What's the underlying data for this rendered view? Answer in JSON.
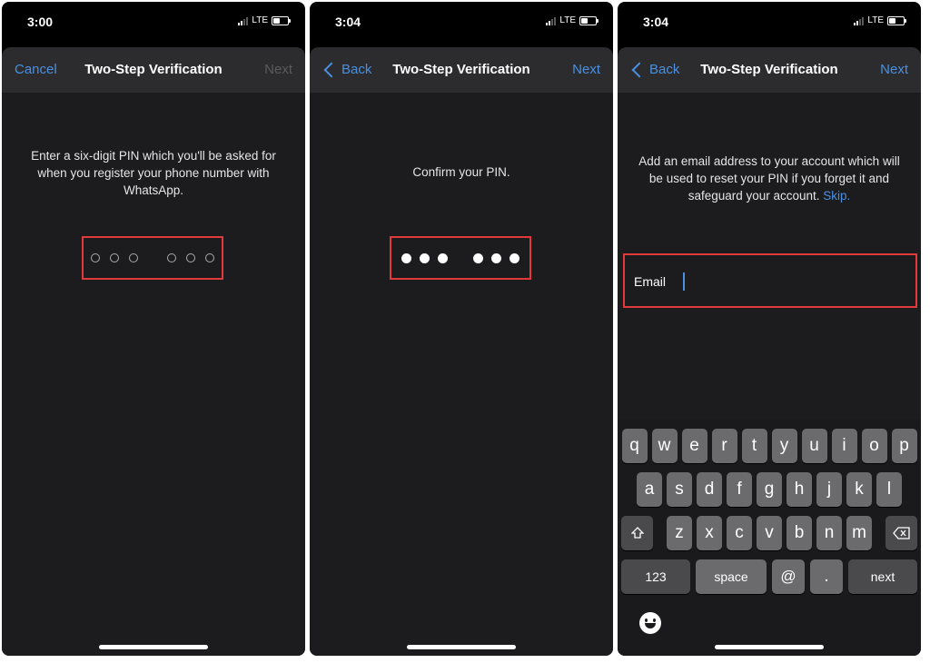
{
  "screens": [
    {
      "time": "3:00",
      "network": "LTE",
      "nav": {
        "left": "Cancel",
        "title": "Two-Step Verification",
        "right": "Next"
      },
      "message": "Enter a six-digit PIN which you'll be asked for when you register your phone number with WhatsApp."
    },
    {
      "time": "3:04",
      "network": "LTE",
      "nav": {
        "left": "Back",
        "title": "Two-Step Verification",
        "right": "Next"
      },
      "message": "Confirm your PIN."
    },
    {
      "time": "3:04",
      "network": "LTE",
      "nav": {
        "left": "Back",
        "title": "Two-Step Verification",
        "right": "Next"
      },
      "message": "Add an email address to your account which will be used to reset your PIN if you forget it and safeguard your account.",
      "skip": "Skip.",
      "email_label": "Email"
    }
  ],
  "keyboard": {
    "row1": [
      "q",
      "w",
      "e",
      "r",
      "t",
      "y",
      "u",
      "i",
      "o",
      "p"
    ],
    "row2": [
      "a",
      "s",
      "d",
      "f",
      "g",
      "h",
      "j",
      "k",
      "l"
    ],
    "row3": [
      "z",
      "x",
      "c",
      "v",
      "b",
      "n",
      "m"
    ],
    "row4": {
      "numbers": "123",
      "space": "space",
      "at": "@",
      "dot": ".",
      "next": "next"
    }
  },
  "colors": {
    "accent": "#4a90e2",
    "highlight": "#e03a3a",
    "background": "#1c1c1e"
  },
  "icons": {
    "back": "chevron-left-icon",
    "shift": "shift-arrow-icon",
    "delete": "backspace-icon",
    "emoji": "emoji-icon"
  }
}
